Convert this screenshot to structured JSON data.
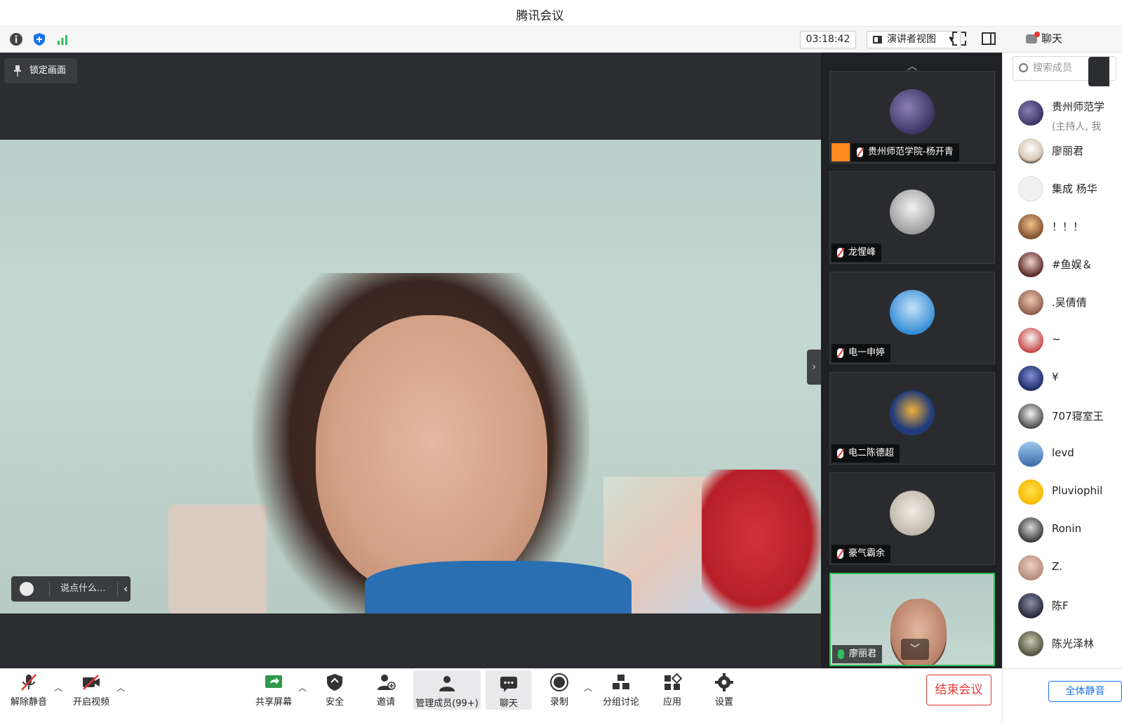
{
  "app": {
    "title": "腾讯会议"
  },
  "topbar": {
    "timer": "03:18:42",
    "view_mode": "演讲者视图",
    "chat_tab": "聊天"
  },
  "stage": {
    "lock_label": "锁定画面",
    "chat_placeholder": "说点什么..."
  },
  "thumbnails": [
    {
      "name": "贵州师范学院-杨开青",
      "host": true,
      "muted": true
    },
    {
      "name": "龙惺峰",
      "host": false,
      "muted": true
    },
    {
      "name": "电一申婷",
      "host": false,
      "muted": true
    },
    {
      "name": "电二陈德超",
      "host": false,
      "muted": true
    },
    {
      "name": "豪气霸余",
      "host": false,
      "muted": true
    },
    {
      "name": "廖丽君",
      "host": false,
      "muted": false,
      "self": true
    }
  ],
  "members": {
    "search_placeholder": "搜索成员",
    "list": [
      {
        "name": "贵州师范学",
        "sub": "(主持人, 我"
      },
      {
        "name": "廖丽君"
      },
      {
        "name": "集成  杨华"
      },
      {
        "name": "！！！"
      },
      {
        "name": "#鱼娱＆"
      },
      {
        "name": ".吴倩倩"
      },
      {
        "name": "~"
      },
      {
        "name": "¥"
      },
      {
        "name": "707寝室王"
      },
      {
        "name": "levd"
      },
      {
        "name": "Pluviophil"
      },
      {
        "name": "Ronin"
      },
      {
        "name": "Z."
      },
      {
        "name": "陈F"
      },
      {
        "name": "陈光泽林"
      }
    ]
  },
  "bottom": {
    "unmute": "解除静音",
    "start_video": "开启视频",
    "share_screen": "共享屏幕",
    "security": "安全",
    "invite": "邀请",
    "manage_members": "管理成员(99+)",
    "chat": "聊天",
    "record": "录制",
    "breakout": "分组讨论",
    "apps": "应用",
    "settings": "设置",
    "end_meeting": "结束会议",
    "mute_all": "全体静音"
  },
  "colors": {
    "accent_green": "#2fbf5a",
    "danger_red": "#e53935",
    "link_blue": "#1a73e8",
    "host_orange": "#ff8a1e"
  }
}
